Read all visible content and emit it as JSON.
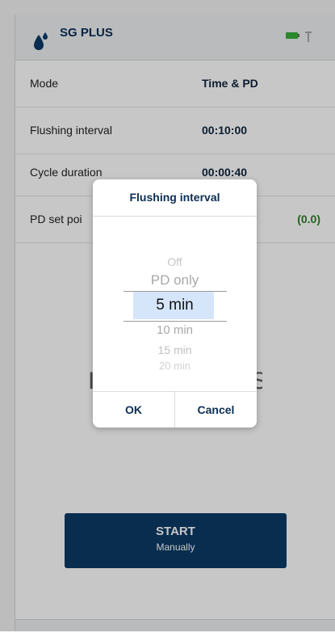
{
  "header": {
    "title": "SG PLUS",
    "icons": {
      "logo": "water-drops-icon",
      "battery": "battery-icon",
      "signal": "signal-antenna-icon"
    }
  },
  "settings": [
    {
      "label": "Mode",
      "value": "Time & PD"
    },
    {
      "label": "Flushing interval",
      "value": "00:10:00"
    },
    {
      "label": "Cycle duration",
      "value": "00:00:40"
    },
    {
      "label": "PD set poi",
      "value": "(0.0)"
    }
  ],
  "background": {
    "partial_left": "I",
    "partial_right": "S"
  },
  "start_button": {
    "label": "START",
    "sublabel": "Manually"
  },
  "dialog": {
    "title": "Flushing interval",
    "options": [
      "Off",
      "PD only",
      "5 min",
      "10 min",
      "15 min",
      "20 min"
    ],
    "selected": "5 min",
    "ok_label": "OK",
    "cancel_label": "Cancel"
  },
  "colors": {
    "primary": "#0b3a66",
    "title": "#0b2e55",
    "value_green": "#2f7d2a",
    "selection": "#d5e6fb"
  }
}
